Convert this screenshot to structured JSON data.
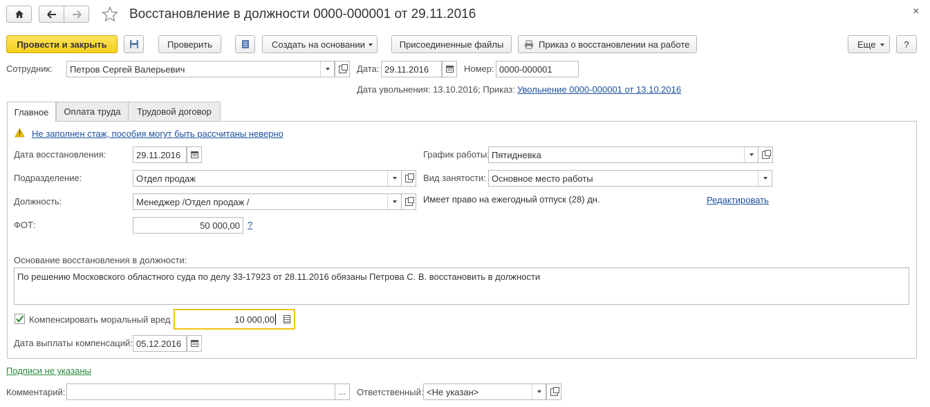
{
  "window": {
    "title": "Восстановление в должности 0000-000001 от 29.11.2016",
    "close_glyph": "×"
  },
  "toolbar": {
    "post_close_label": "Провести и закрыть",
    "check_label": "Проверить",
    "create_based_label": "Создать на основании",
    "attached_files_label": "Присоединенные файлы",
    "print_order_label": "Приказ о восстановлении на работе",
    "more_label": "Еще",
    "help_label": "?"
  },
  "header": {
    "employee_label": "Сотрудник:",
    "employee_value": "Петров Сергей Валерьевич",
    "date_label": "Дата:",
    "date_value": "29.11.2016",
    "number_label": "Номер:",
    "number_value": "0000-000001",
    "dismissal_info": "Дата увольнения: 13.10.2016; Приказ:",
    "dismissal_link": "Увольнение 0000-000001 от 13.10.2016"
  },
  "tabs": [
    {
      "label": "Главное",
      "active": true
    },
    {
      "label": "Оплата труда",
      "active": false
    },
    {
      "label": "Трудовой договор",
      "active": false
    }
  ],
  "main": {
    "warning_link": "Не заполнен стаж, пособия могут быть рассчитаны неверно",
    "restore_date_label": "Дата восстановления:",
    "restore_date_value": "29.11.2016",
    "department_label": "Подразделение:",
    "department_value": "Отдел продаж",
    "position_label": "Должность:",
    "position_value": "Менеджер /Отдел продаж /",
    "payroll_label": "ФОТ:",
    "payroll_value": "50 000,00",
    "payroll_help": "?",
    "schedule_label": "График работы:",
    "schedule_value": "Пятидневка",
    "employment_type_label": "Вид занятости:",
    "employment_type_value": "Основное место работы",
    "vacation_info": "Имеет право на ежегодный отпуск (28) дн.",
    "edit_link": "Редактировать",
    "basis_label": "Основание восстановления в должности:",
    "basis_value": "По решению Московского областного суда по делу 33-17923 от 28.11.2016 обязаны Петрова С. В. восстановить в должности",
    "compensate_label": "Компенсировать моральный вред",
    "compensate_checked": true,
    "compensate_value": "10 000,00",
    "payment_date_label": "Дата выплаты компенсаций:",
    "payment_date_value": "05.12.2016"
  },
  "footer": {
    "signatures_link": "Подписи не указаны",
    "comment_label": "Комментарий:",
    "comment_value": "",
    "comment_button": "...",
    "responsible_label": "Ответственный:",
    "responsible_value": "<Не указан>"
  },
  "colors": {
    "primary_button": "#f5cf1c",
    "link": "#1c4f9c",
    "link_green": "#2a8a3a",
    "active_field_border": "#f0c20a",
    "warning": "#f3c300"
  }
}
